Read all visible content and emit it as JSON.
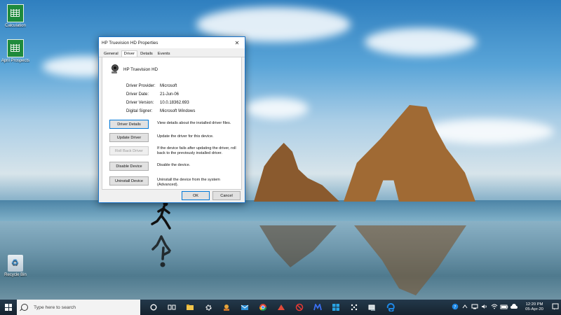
{
  "desktop": {
    "icons": [
      {
        "label": "Calculation",
        "type": "sheet"
      },
      {
        "label": "April Prospects",
        "type": "sheet"
      },
      {
        "label": "Recycle Bin",
        "type": "bin"
      }
    ]
  },
  "dialog": {
    "title": "HP Truevision HD Properties",
    "close_symbol": "✕",
    "tabs": [
      "General",
      "Driver",
      "Details",
      "Events"
    ],
    "active_tab": "Driver",
    "device_name": "HP Truevision HD",
    "properties": [
      {
        "label": "Driver Provider:",
        "value": "Microsoft"
      },
      {
        "label": "Driver Date:",
        "value": "21-Jun-06"
      },
      {
        "label": "Driver Version:",
        "value": "10.0.18362.693"
      },
      {
        "label": "Digital Signer:",
        "value": "Microsoft Windows"
      }
    ],
    "actions": [
      {
        "button": "Driver Details",
        "description": "View details about the installed driver files."
      },
      {
        "button": "Update Driver",
        "description": "Update the driver for this device."
      },
      {
        "button": "Roll Back Driver",
        "description": "If the device fails after updating the driver, roll back to the previously installed driver."
      },
      {
        "button": "Disable Device",
        "description": "Disable the device."
      },
      {
        "button": "Uninstall Device",
        "description": "Uninstall the device from the system (Advanced)."
      }
    ],
    "ok_label": "OK",
    "cancel_label": "Cancel"
  },
  "taskbar": {
    "search_placeholder": "Type here to search",
    "pinned": [
      "cortana-icon",
      "task-view-icon",
      "file-explorer-icon",
      "settings-icon",
      "app-icon",
      "mail-icon",
      "chrome-icon",
      "app-icon",
      "blocked-icon",
      "app-icon",
      "store-icon",
      "app-icon",
      "device-manager-icon",
      "edge-icon"
    ],
    "tray": [
      "help-icon",
      "chevron-up-icon",
      "network-icon",
      "volume-icon",
      "wifi-icon",
      "battery-icon",
      "cloud-icon"
    ],
    "time": "12:20 PM",
    "date": "05-Apr-20"
  },
  "colors": {
    "accent": "#0078d7",
    "taskbar": "#1a2a3a"
  }
}
